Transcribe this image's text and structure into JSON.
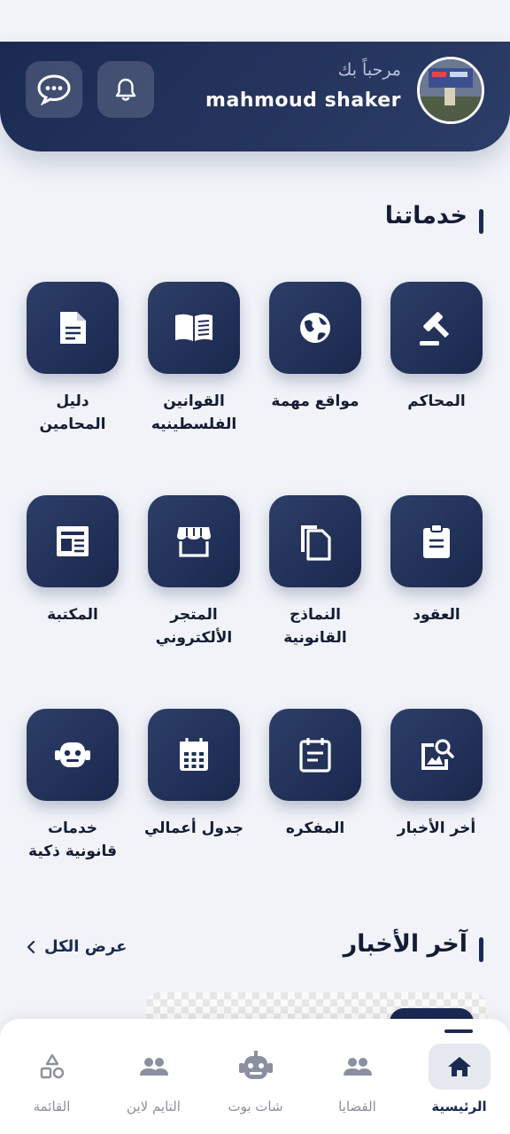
{
  "header": {
    "greeting": "مرحباً بك",
    "username": "mahmoud shaker"
  },
  "services": {
    "title": "خدماتنا",
    "items": [
      {
        "label": "المحاكم",
        "icon": "gavel-icon"
      },
      {
        "label": "مواقع مهمة",
        "icon": "globe-icon"
      },
      {
        "label": "القوانين\nالفلسطينيه",
        "icon": "book-icon"
      },
      {
        "label": "دليل\nالمحامين",
        "icon": "document-icon"
      },
      {
        "label": "العقود",
        "icon": "clipboard-icon"
      },
      {
        "label": "النماذج\nالقانونية",
        "icon": "copy-files-icon"
      },
      {
        "label": "المتجر\nالألكتروني",
        "icon": "store-icon"
      },
      {
        "label": "المكتبة",
        "icon": "newspaper-icon"
      },
      {
        "label": "أخر الأخبار",
        "icon": "image-search-icon"
      },
      {
        "label": "المفكره",
        "icon": "notes-icon"
      },
      {
        "label": "جدول أعمالي",
        "icon": "calendar-icon"
      },
      {
        "label": "خدمات\nقانونية ذكية",
        "icon": "robot-icon"
      }
    ]
  },
  "news": {
    "title": "آخر الأخبار",
    "view_all": "عرض الكل"
  },
  "nav": {
    "items": [
      {
        "label": "الرئيسية",
        "icon": "home-icon",
        "active": true
      },
      {
        "label": "القضايا",
        "icon": "people-icon",
        "active": false
      },
      {
        "label": "شات بوت",
        "icon": "robot-icon",
        "active": false
      },
      {
        "label": "التايم لاين",
        "icon": "people-icon",
        "active": false
      },
      {
        "label": "القائمة",
        "icon": "shapes-icon",
        "active": false
      }
    ]
  },
  "colors": {
    "primary": "#1b2a52",
    "background": "#f1f3f9"
  }
}
